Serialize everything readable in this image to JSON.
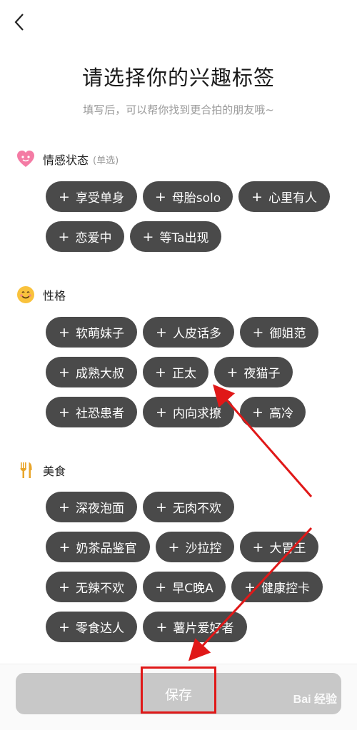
{
  "nav": {
    "back_icon": "chevron-left-icon"
  },
  "header": {
    "title": "请选择你的兴趣标签",
    "subtitle": "填写后，可以帮你找到更合拍的朋友哦~"
  },
  "sections": [
    {
      "name": "情感状态",
      "note": "(单选)",
      "icon": "heart-face-icon",
      "tags": [
        "享受单身",
        "母胎solo",
        "心里有人",
        "恋爱中",
        "等Ta出现"
      ]
    },
    {
      "name": "性格",
      "note": "",
      "icon": "smiling-face-icon",
      "tags": [
        "软萌妹子",
        "人皮话多",
        "御姐范",
        "成熟大叔",
        "正太",
        "夜猫子",
        "社恐患者",
        "内向求撩",
        "高冷"
      ]
    },
    {
      "name": "美食",
      "note": "",
      "icon": "fork-knife-icon",
      "tags": [
        "深夜泡面",
        "无肉不欢",
        "奶茶品鉴官",
        "沙拉控",
        "大胃王",
        "无辣不欢",
        "早C晚A",
        "健康控卡",
        "零食达人",
        "薯片爱好者"
      ]
    }
  ],
  "tag_prefix": "+",
  "footer": {
    "save_label": "保存"
  },
  "watermark": "Bai 经验",
  "colors": {
    "tag_bg": "#4a4a4a",
    "tag_text": "#ffffff",
    "save_bg": "#c8c8c8",
    "annotation": "#e01818"
  }
}
